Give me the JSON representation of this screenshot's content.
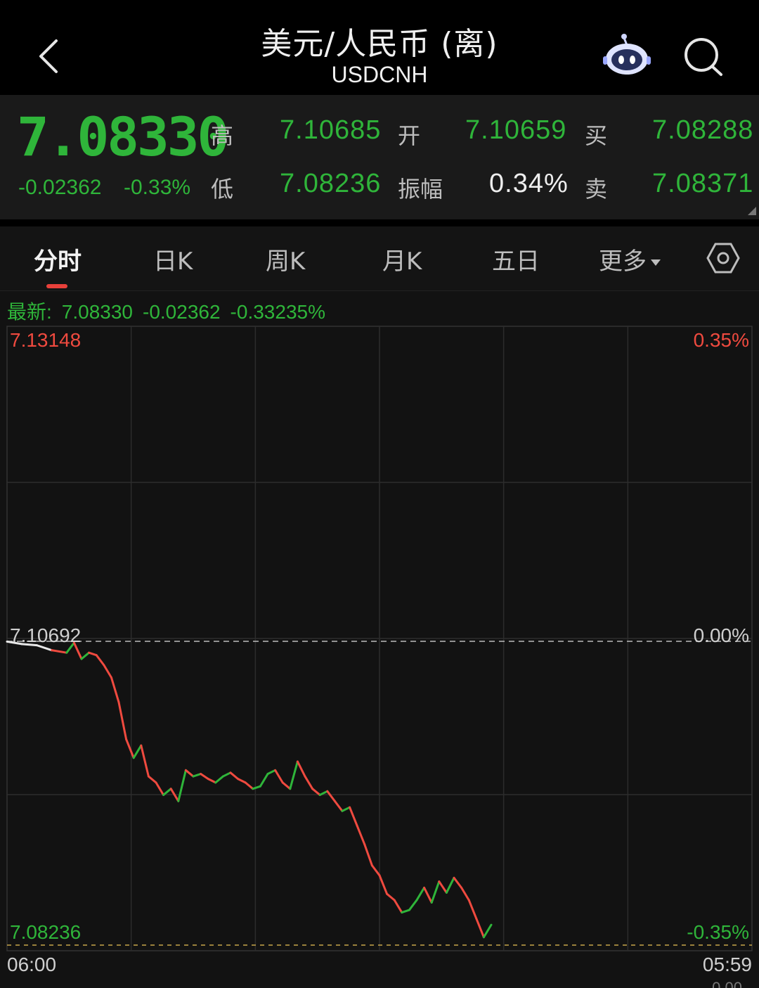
{
  "header": {
    "title": "美元/人民币 (离)",
    "subtitle": "USDCNH",
    "back_icon": "chevron-left-icon",
    "robot_icon": "robot-assistant-icon",
    "search_icon": "search-icon"
  },
  "quote": {
    "last_price": "7.08330",
    "change": "-0.02362",
    "change_pct": "-0.33%",
    "high_label": "高",
    "high": "7.10685",
    "low_label": "低",
    "low": "7.08236",
    "open_label": "开",
    "open": "7.10659",
    "amplitude_label": "振幅",
    "amplitude": "0.34%",
    "bid_label": "买",
    "bid": "7.08288",
    "ask_label": "卖",
    "ask": "7.08371"
  },
  "tabs": [
    {
      "label": "分时",
      "active": true
    },
    {
      "label": "日K",
      "active": false
    },
    {
      "label": "周K",
      "active": false
    },
    {
      "label": "月K",
      "active": false
    },
    {
      "label": "五日",
      "active": false
    },
    {
      "label": "更多",
      "active": false
    }
  ],
  "latest": {
    "label": "最新:",
    "price": "7.08330",
    "change": "-0.02362",
    "change_pct": "-0.33235%"
  },
  "chart_data": {
    "type": "line",
    "y_top_label": "7.13148",
    "y_ref_label": "7.10692",
    "y_bottom_label": "7.08236",
    "pct_top_label": "0.35%",
    "pct_ref_label": "0.00%",
    "pct_bottom_label": "-0.35%",
    "ylim": [
      7.08236,
      7.13148
    ],
    "reference": 7.10692,
    "time_start": "06:00",
    "time_end": "05:59",
    "bottom_cut_label": "0.00",
    "series": [
      {
        "x": [
          0,
          0.02,
          0.04,
          0.06,
          0.08,
          0.09,
          0.1,
          0.11,
          0.12,
          0.13,
          0.14,
          0.15,
          0.16,
          0.17,
          0.18,
          0.19,
          0.2,
          0.21,
          0.22,
          0.23,
          0.24,
          0.25,
          0.26,
          0.27,
          0.28,
          0.29,
          0.3,
          0.31,
          0.32,
          0.33,
          0.34,
          0.35,
          0.36,
          0.37,
          0.38,
          0.39,
          0.4,
          0.41,
          0.42,
          0.43,
          0.44,
          0.45,
          0.46,
          0.47,
          0.48,
          0.49,
          0.5,
          0.51,
          0.52,
          0.53,
          0.54,
          0.55,
          0.56,
          0.57,
          0.58,
          0.59,
          0.6,
          0.61,
          0.62,
          0.63,
          0.64,
          0.65
        ],
        "values": [
          7.1069,
          7.1067,
          7.1066,
          7.1062,
          7.106,
          7.1068,
          7.1055,
          7.106,
          7.1058,
          7.105,
          7.104,
          7.102,
          7.099,
          7.0975,
          7.0985,
          7.096,
          7.0955,
          7.0945,
          7.095,
          7.094,
          7.0965,
          7.096,
          7.0962,
          7.0958,
          7.0955,
          7.096,
          7.0963,
          7.0958,
          7.0955,
          7.095,
          7.0952,
          7.0962,
          7.0965,
          7.0955,
          7.095,
          7.0972,
          7.096,
          7.095,
          7.0945,
          7.0948,
          7.094,
          7.0932,
          7.0935,
          7.092,
          7.0905,
          7.0888,
          7.088,
          7.0865,
          7.086,
          7.085,
          7.0852,
          7.086,
          7.087,
          7.0858,
          7.0875,
          7.0866,
          7.0878,
          7.087,
          7.086,
          7.0845,
          7.083,
          7.084
        ]
      }
    ]
  }
}
